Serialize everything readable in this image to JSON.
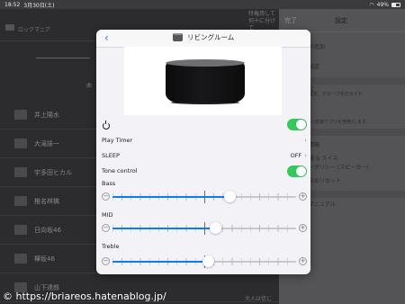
{
  "status_bar": {
    "time": "18:52",
    "date": "3月30日(土)",
    "battery": "49%"
  },
  "background_app": {
    "header_title": "ロックマニア",
    "header_right_line1": "特権用して",
    "header_right_line2": "何十に分けて",
    "tab_label": "曲",
    "list_items": [
      "井上陽水",
      "大滝詠一",
      "宇多田ヒカル",
      "椎名林檎",
      "日向坂46",
      "欅坂46",
      "山下達郎"
    ],
    "bottom_text": "大人は信じ"
  },
  "settings_panel": {
    "close_label": "完了",
    "title": "設定",
    "items": [
      "の追加",
      "設定",
      "定",
      "設定、グループ化のガイド",
      "ト(音楽アプリを使用)します。",
      "情報",
      "規 & スイス",
      "ーポリシー (スピーカー)",
      "タのリセット",
      "マニュアル"
    ]
  },
  "modal": {
    "back_icon": "chevron-left-icon",
    "title": "リビングルーム",
    "power": {
      "icon": "power-icon",
      "on": true
    },
    "play_timer": {
      "label": "Play Timer",
      "value": ""
    },
    "sleep": {
      "label": "SLEEP",
      "value": "OFF"
    },
    "tone_control": {
      "label": "Tone control",
      "on": true
    },
    "sliders": [
      {
        "key": "bass",
        "label": "Bass",
        "value_fraction": 0.64
      },
      {
        "key": "mid",
        "label": "MID",
        "value_fraction": 0.56
      },
      {
        "key": "treble",
        "label": "Treble",
        "value_fraction": 0.52
      }
    ],
    "toggle_color": "#34c759",
    "accent_color": "#0a7aff"
  },
  "watermark": "© https://briareos.hatenablog.jp/"
}
